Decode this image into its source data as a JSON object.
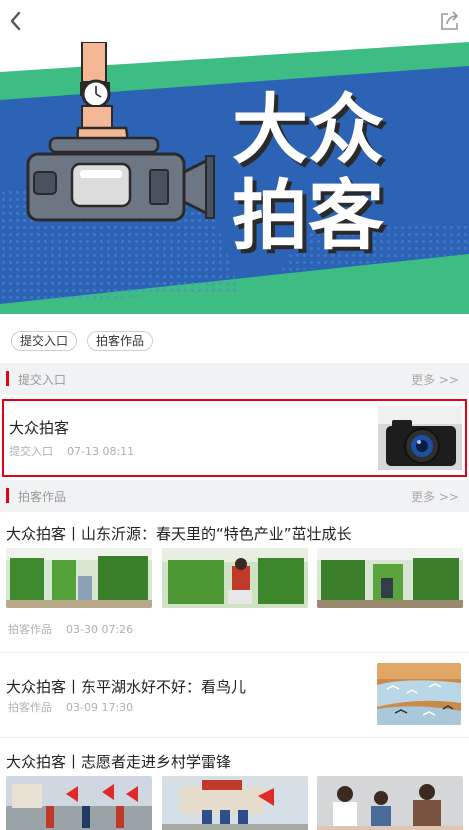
{
  "banner": {
    "title_line1": "大众",
    "title_line2": "拍客",
    "colors": {
      "blue": "#2c63b4",
      "green": "#3dbd84",
      "title": "#ffffff"
    }
  },
  "chips": [
    {
      "label": "提交入口"
    },
    {
      "label": "拍客作品"
    }
  ],
  "sections": {
    "submit": {
      "title": "提交入口",
      "more": "更多 >>"
    },
    "works": {
      "title": "拍客作品",
      "more": "更多 >>"
    }
  },
  "highlight_item": {
    "title": "大众拍客",
    "source": "提交入口",
    "time": "07-13 08:11",
    "icon": "camera-photo"
  },
  "articles": [
    {
      "title": "大众拍客丨山东沂源：春天里的“特色产业”茁壮成长",
      "source": "拍客作品",
      "time": "03-30 07:26"
    },
    {
      "title": "大众拍客丨东平湖水好不好：看鸟儿",
      "source": "拍客作品",
      "time": "03-09 17:30"
    },
    {
      "title": "大众拍客丨志愿者走进乡村学雷锋"
    }
  ],
  "accent_color": "#e60012"
}
